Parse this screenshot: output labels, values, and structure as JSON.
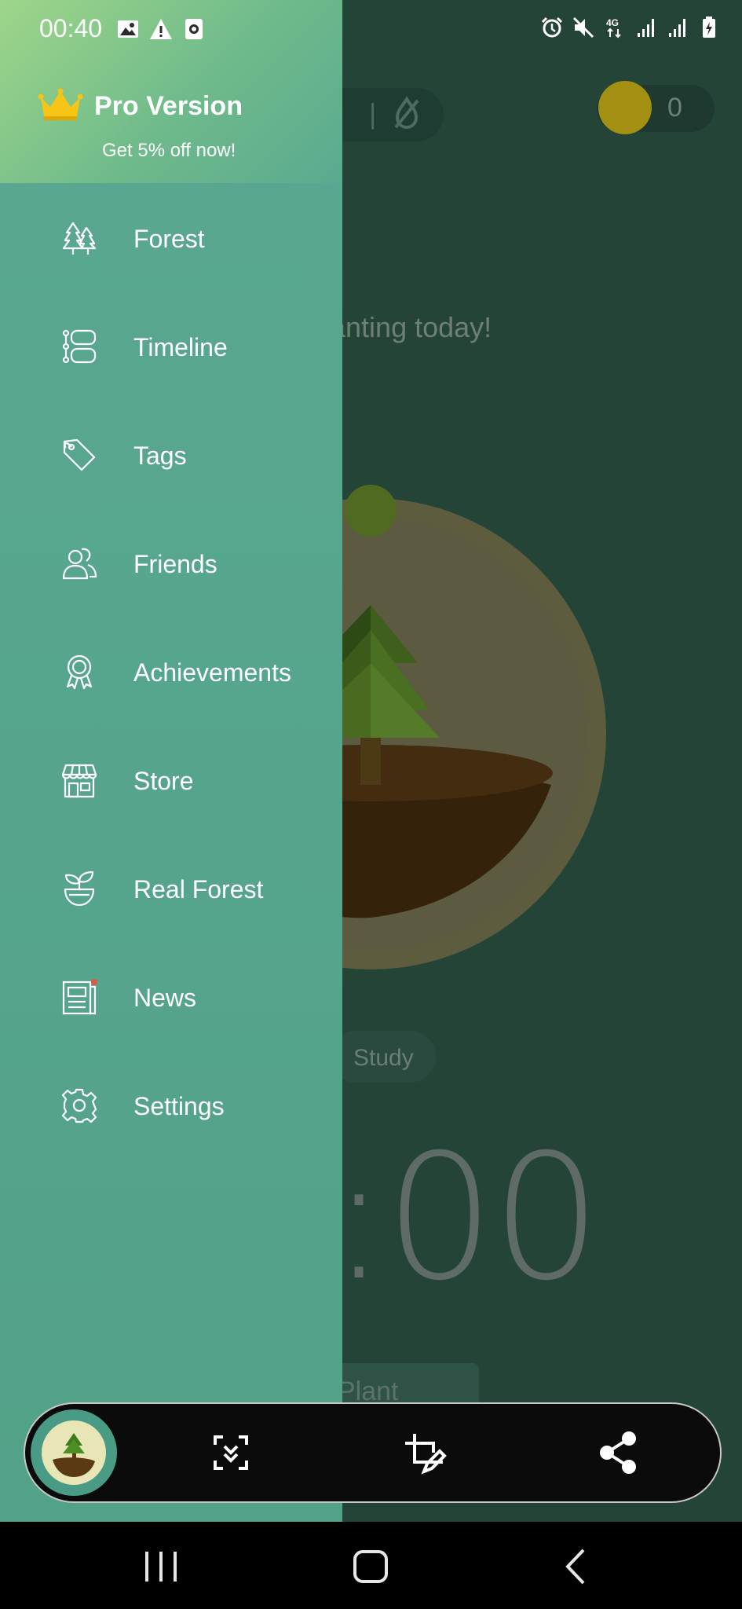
{
  "status_bar": {
    "time": "00:40",
    "left_icons": [
      "image-icon",
      "warning-icon",
      "screen-record-icon"
    ],
    "right_icons": [
      "alarm-icon",
      "mute-icon",
      "network-4g-icon",
      "signal-icon",
      "signal-icon",
      "battery-charging-icon"
    ]
  },
  "background_app": {
    "coin_count": "0",
    "planting_text": "anting today!",
    "tag_label": "Study",
    "timer": ":00",
    "plant_button": "Plant"
  },
  "drawer": {
    "pro_title": "Pro Version",
    "pro_subtitle": "Get 5% off now!",
    "items": [
      {
        "label": "Forest",
        "icon": "forest-icon"
      },
      {
        "label": "Timeline",
        "icon": "timeline-icon"
      },
      {
        "label": "Tags",
        "icon": "tag-icon"
      },
      {
        "label": "Friends",
        "icon": "friends-icon"
      },
      {
        "label": "Achievements",
        "icon": "achievement-icon"
      },
      {
        "label": "Store",
        "icon": "store-icon"
      },
      {
        "label": "Real Forest",
        "icon": "sprout-icon"
      },
      {
        "label": "News",
        "icon": "news-icon"
      },
      {
        "label": "Settings",
        "icon": "gear-icon"
      }
    ]
  },
  "toolbar": {
    "buttons": [
      "scroll-capture-icon",
      "crop-edit-icon",
      "share-icon"
    ]
  },
  "nav_bar": {
    "buttons": [
      "recents-icon",
      "home-icon",
      "back-icon"
    ]
  },
  "colors": {
    "drawer_bg": "#52a188",
    "header_gradient_start": "#9ed68a",
    "app_bg": "#244438",
    "crown": "#f5c518",
    "news_badge": "#e0584a"
  }
}
